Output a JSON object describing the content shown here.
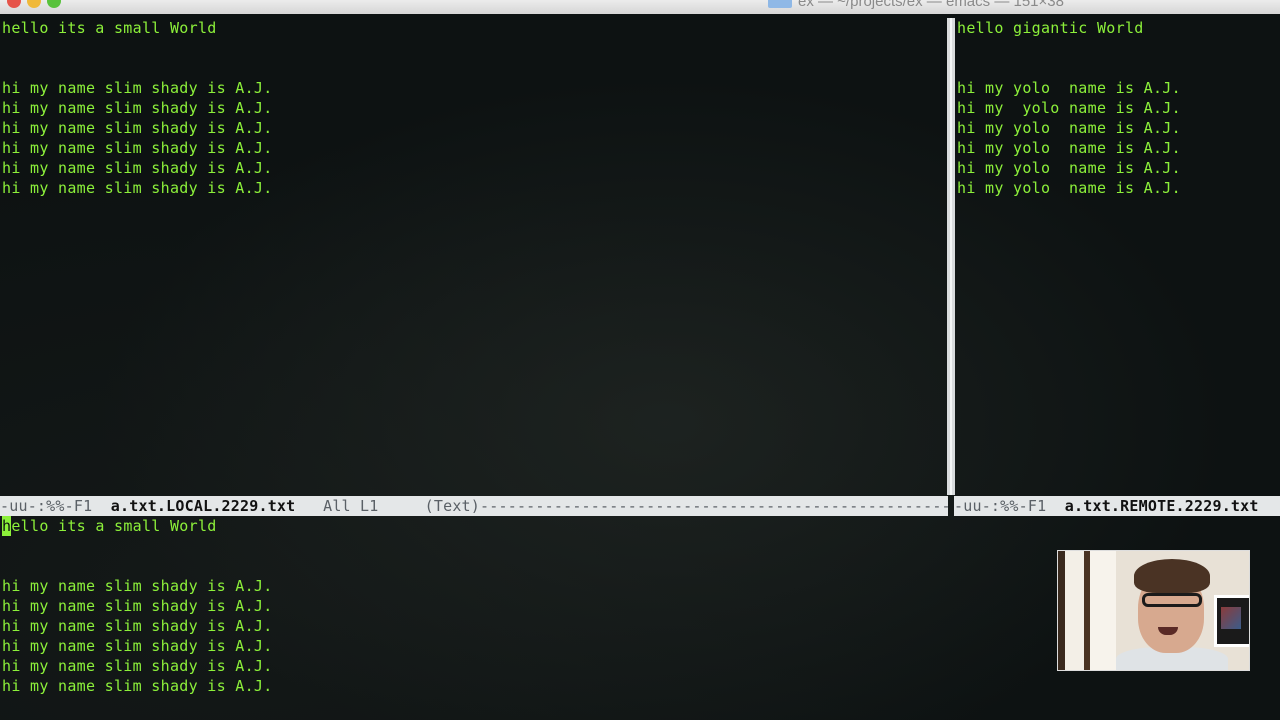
{
  "window": {
    "title": "ex — ~/projects/ex — emacs — 151×38"
  },
  "panes": {
    "local": {
      "lines": [
        "hello its a small World",
        "",
        "",
        "hi my name slim shady is A.J.",
        "hi my name slim shady is A.J.",
        "hi my name slim shady is A.J.",
        "hi my name slim shady is A.J.",
        "hi my name slim shady is A.J.",
        "hi my name slim shady is A.J."
      ]
    },
    "remote": {
      "lines": [
        "hello gigantic World",
        "",
        "",
        "hi my yolo  name is A.J.",
        "hi my  yolo name is A.J.",
        "hi my yolo  name is A.J.",
        "hi my yolo  name is A.J.",
        "hi my yolo  name is A.J.",
        "hi my yolo  name is A.J."
      ]
    },
    "merged": {
      "cursor_char": "h",
      "first_line_rest": "ello its a small World",
      "lines": [
        "",
        "",
        "hi my name slim shady is A.J.",
        "hi my name slim shady is A.J.",
        "hi my name slim shady is A.J.",
        "hi my name slim shady is A.J.",
        "hi my name slim shady is A.J.",
        "hi my name slim shady is A.J."
      ]
    }
  },
  "modelines": {
    "local": {
      "prefix": "-uu-:%%-F1  ",
      "buffer": "a.txt.LOCAL.2229.txt",
      "suffix": "   All L1     (Text)------------------------------------------------------------------"
    },
    "remote": {
      "prefix": "-uu-:%%-F1  ",
      "buffer": "a.txt.REMOTE.2229.txt",
      "suffix": ""
    }
  },
  "colors": {
    "text": "#8cf03a",
    "background": "#0d1212",
    "modeline": "#e4e7e8"
  }
}
